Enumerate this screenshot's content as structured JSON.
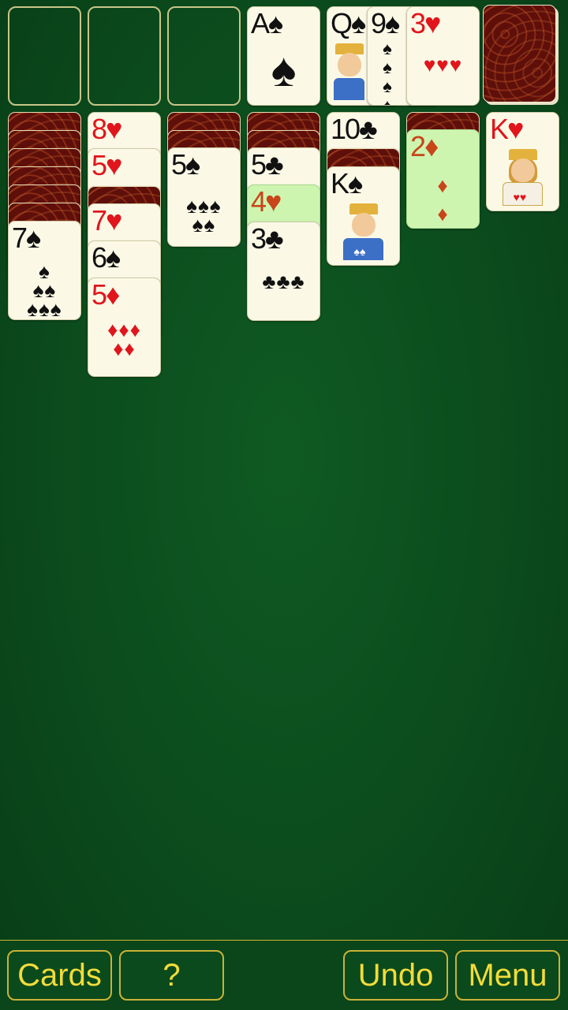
{
  "tableau": {
    "col1": {
      "card": {
        "rank": "7",
        "suit": "♠",
        "pips": [
          "♠",
          "♠♠",
          "♠♠♠"
        ]
      }
    },
    "col2": {
      "c1": {
        "rank": "8",
        "suit": "♥"
      },
      "c2": {
        "rank": "5",
        "suit": "♥"
      },
      "c3": {
        "rank": "7",
        "suit": "♥"
      },
      "c4": {
        "rank": "6",
        "suit": "♠"
      },
      "c5": {
        "rank": "5",
        "suit": "♦",
        "pips": [
          "♦",
          "♦♦♦",
          "♦♦"
        ]
      }
    },
    "col3": {
      "card": {
        "rank": "5",
        "suit": "♠",
        "pips": [
          "♠♠♠",
          "♠♠"
        ]
      }
    },
    "col4": {
      "c1": {
        "rank": "5",
        "suit": "♣"
      },
      "c2": {
        "rank": "4",
        "suit": "♥"
      },
      "c3": {
        "rank": "3",
        "suit": "♣",
        "pips": [
          "♣♣♣"
        ]
      }
    },
    "col5": {
      "c1": {
        "rank": "10",
        "suit": "♣"
      },
      "c2": {
        "rank": "K",
        "suit": "♠"
      }
    },
    "col6": {
      "card": {
        "rank": "2",
        "suit": "♦",
        "pips": [
          "♦",
          "♦"
        ]
      }
    },
    "col7": {
      "card": {
        "rank": "K",
        "suit": "♥"
      }
    }
  },
  "foundation": {
    "ace": {
      "rank": "A",
      "suit": "♠"
    }
  },
  "waste": {
    "c1": {
      "rank": "Q",
      "suit": "♠"
    },
    "c2": {
      "rank": "9",
      "suit": "♠",
      "pips": [
        "♠",
        "♠",
        "♠",
        "♠"
      ]
    },
    "c3": {
      "rank": "3",
      "suit": "♥",
      "pips": [
        "♥",
        "♥♥♥"
      ]
    }
  },
  "toolbar": {
    "cards_label": "Cards",
    "help_label": "?",
    "undo_label": "Undo",
    "menu_label": "Menu"
  },
  "colors": {
    "felt": "#0b4a1c",
    "button_text": "#f2dc3a",
    "button_border": "#c9b338",
    "highlight": "#cdf5b0"
  }
}
